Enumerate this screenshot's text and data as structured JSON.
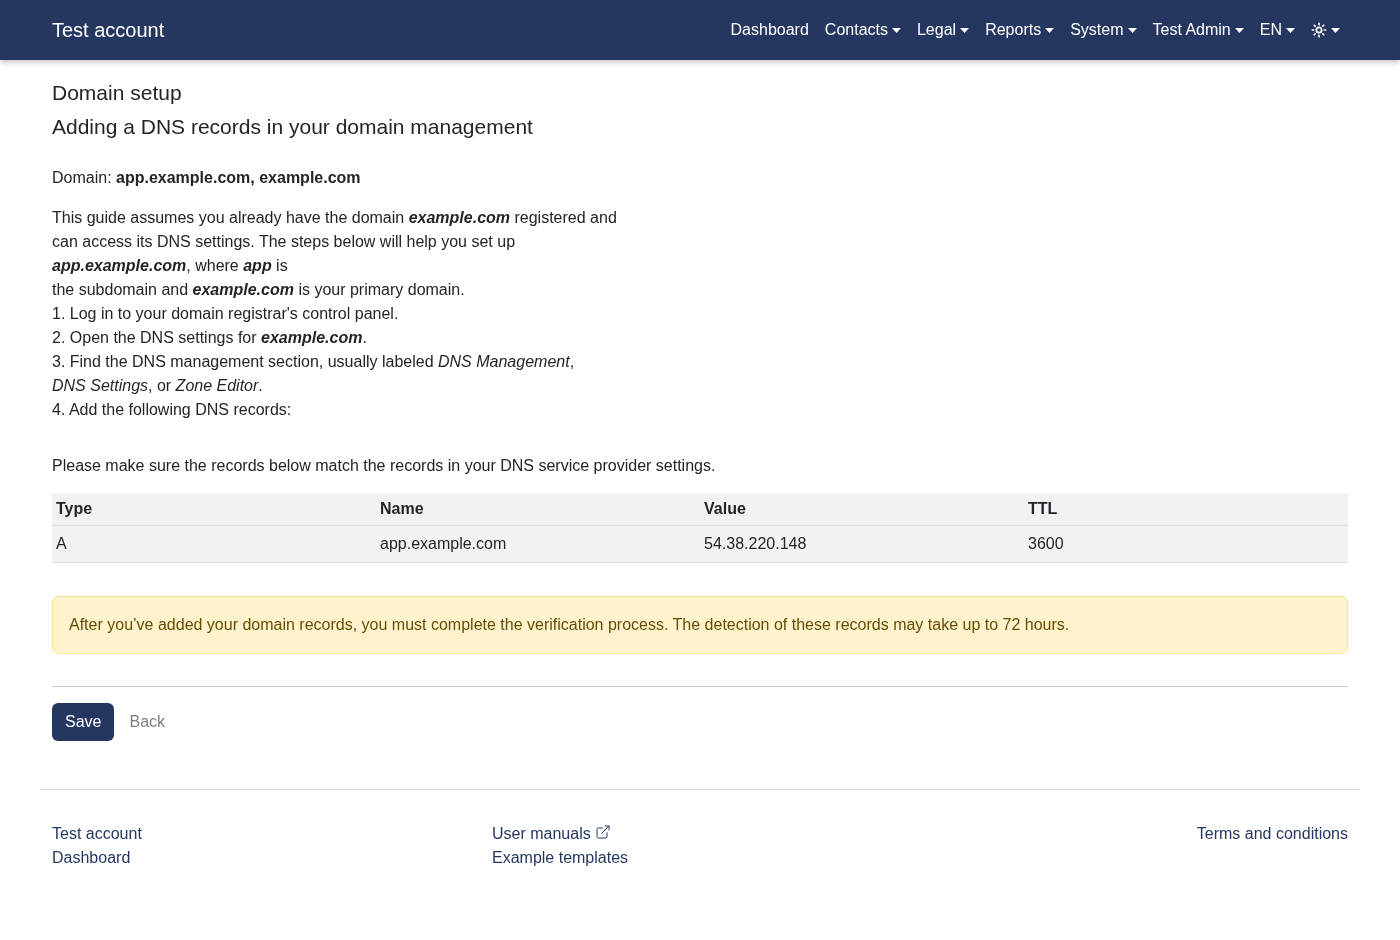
{
  "navbar": {
    "brand": "Test account",
    "items": [
      {
        "kind": "link",
        "label": "Dashboard"
      },
      {
        "kind": "dropdown",
        "label": "Contacts"
      },
      {
        "kind": "dropdown",
        "label": "Legal"
      },
      {
        "kind": "dropdown",
        "label": "Reports"
      },
      {
        "kind": "dropdown",
        "label": "System"
      },
      {
        "kind": "dropdown",
        "label": "Test Admin"
      },
      {
        "kind": "dropdown",
        "label": "EN"
      },
      {
        "kind": "theme"
      }
    ]
  },
  "page": {
    "title": "Domain setup",
    "subtitle": "Adding a DNS records in your domain management"
  },
  "domain_line": "Domain: **app.example.com, example.com**",
  "intro": [
    "This guide assumes you already have the domain **example.com** registered and",
    "can access its DNS settings. The steps below will help you set up",
    "**app.example.com**, where **app** is",
    "the subdomain and **example.com** is your primary domain."
  ],
  "steps": [
    [
      "1. Log in to your domain registrar's control panel."
    ],
    [
      "2. Open the DNS settings for **example.com**."
    ],
    [
      "3. Find the DNS management section, usually labeled *DNS Management*,",
      "*DNS Settings*, or *Zone Editor*."
    ],
    [
      "4. Add the following DNS records:"
    ]
  ],
  "notice": "Please make sure the records below match the records in your DNS service provider settings.",
  "table": {
    "columns": [
      "Type",
      "Name",
      "Value",
      "TTL"
    ],
    "rows": [
      [
        "A",
        "app.example.com",
        "54.38.220.148",
        "3600"
      ]
    ]
  },
  "alert": "After you’ve added your domain records, you must complete the verification process. The detection of these records may take up to 72 hours.",
  "actions": [
    {
      "kind": "primary",
      "label": "Save"
    },
    {
      "kind": "link",
      "label": "Back"
    }
  ],
  "footer": {
    "columns": [
      [
        {
          "label": "Test account",
          "external": false
        },
        {
          "label": "Dashboard",
          "external": false
        }
      ],
      [
        {
          "label": "User manuals",
          "external": true
        },
        {
          "label": "Example templates",
          "external": false
        }
      ],
      [
        {
          "label": "Terms and conditions",
          "external": false
        }
      ]
    ]
  }
}
